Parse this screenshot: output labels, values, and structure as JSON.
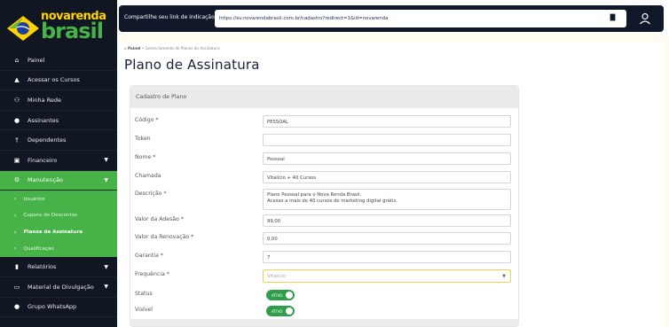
{
  "brand": {
    "line1": "novarenda",
    "line2": "brasil"
  },
  "sidebar": {
    "items": [
      {
        "label": "Painel",
        "icon": "home-icon",
        "glyph": "⌂"
      },
      {
        "label": "Acessar os Cursos",
        "icon": "graduation-cap-icon",
        "glyph": "🎓"
      },
      {
        "label": "Minha Rede",
        "icon": "network-icon",
        "glyph": "⚇"
      },
      {
        "label": "Assinantes",
        "icon": "user-icon",
        "glyph": "●"
      },
      {
        "label": "Dependentes",
        "icon": "person-icon",
        "glyph": "†"
      },
      {
        "label": "Financeiro",
        "icon": "money-icon",
        "glyph": "▣"
      },
      {
        "label": "Manutenção",
        "icon": "gear-icon",
        "glyph": "⚙"
      }
    ],
    "submenu": [
      {
        "label": "Usuários"
      },
      {
        "label": "Cupons de Descontos"
      },
      {
        "label": "Planos de Assinatura"
      },
      {
        "label": "Qualificação"
      }
    ],
    "bottom_items": [
      {
        "label": "Relatórios",
        "icon": "bar-chart-icon",
        "glyph": "▮"
      },
      {
        "label": "Material de Divulgação",
        "icon": "folder-open-icon",
        "glyph": "▭"
      },
      {
        "label": "Grupo WhatsApp",
        "icon": "chat-icon",
        "glyph": "●"
      }
    ]
  },
  "topbar": {
    "share_label": "Compartilhe seu link de indicação:",
    "link": "https://ev.novarendabrasil.com.br/cadastro?redirect=1&id=novarenda"
  },
  "breadcrumb": {
    "home": "Painel",
    "sep": "•",
    "current": "Gerenciamento de Planos de Assinatura"
  },
  "page": {
    "title": "Plano de Assinatura"
  },
  "card": {
    "header": "Cadastro de Plano"
  },
  "form": {
    "codigo": {
      "label": "Código *",
      "value": "PESSOAL"
    },
    "token": {
      "label": "Token",
      "value": ""
    },
    "nome": {
      "label": "Nome *",
      "value": "Pessoal"
    },
    "chamada": {
      "label": "Chamada",
      "value": "Vitalício + 40 Cursos"
    },
    "descricao": {
      "label": "Descrição *",
      "value_line1": "Plano Pessoal para o Nova Renda Brasil.",
      "value_line2": "Acesso a mais de 40 cursos de marketing digital grátis."
    },
    "valor_adesao": {
      "label": "Valor da Adesão *",
      "value": "99,00"
    },
    "valor_renovacao": {
      "label": "Valor da Renovação *",
      "value": "0,00"
    },
    "garantia": {
      "label": "Garantia *",
      "value": "7"
    },
    "frequencia": {
      "label": "Frequência *",
      "value": "Vitalício"
    },
    "status": {
      "label": "Status",
      "toggle_text": "ATIVO"
    },
    "visivel": {
      "label": "Visível",
      "toggle_text": "ATIVO"
    }
  },
  "colors": {
    "sidebar_bg": "#101722",
    "accent_green": "#46b247",
    "toggle_green": "#2e9e4a",
    "brand_yellow": "#ffd200"
  }
}
